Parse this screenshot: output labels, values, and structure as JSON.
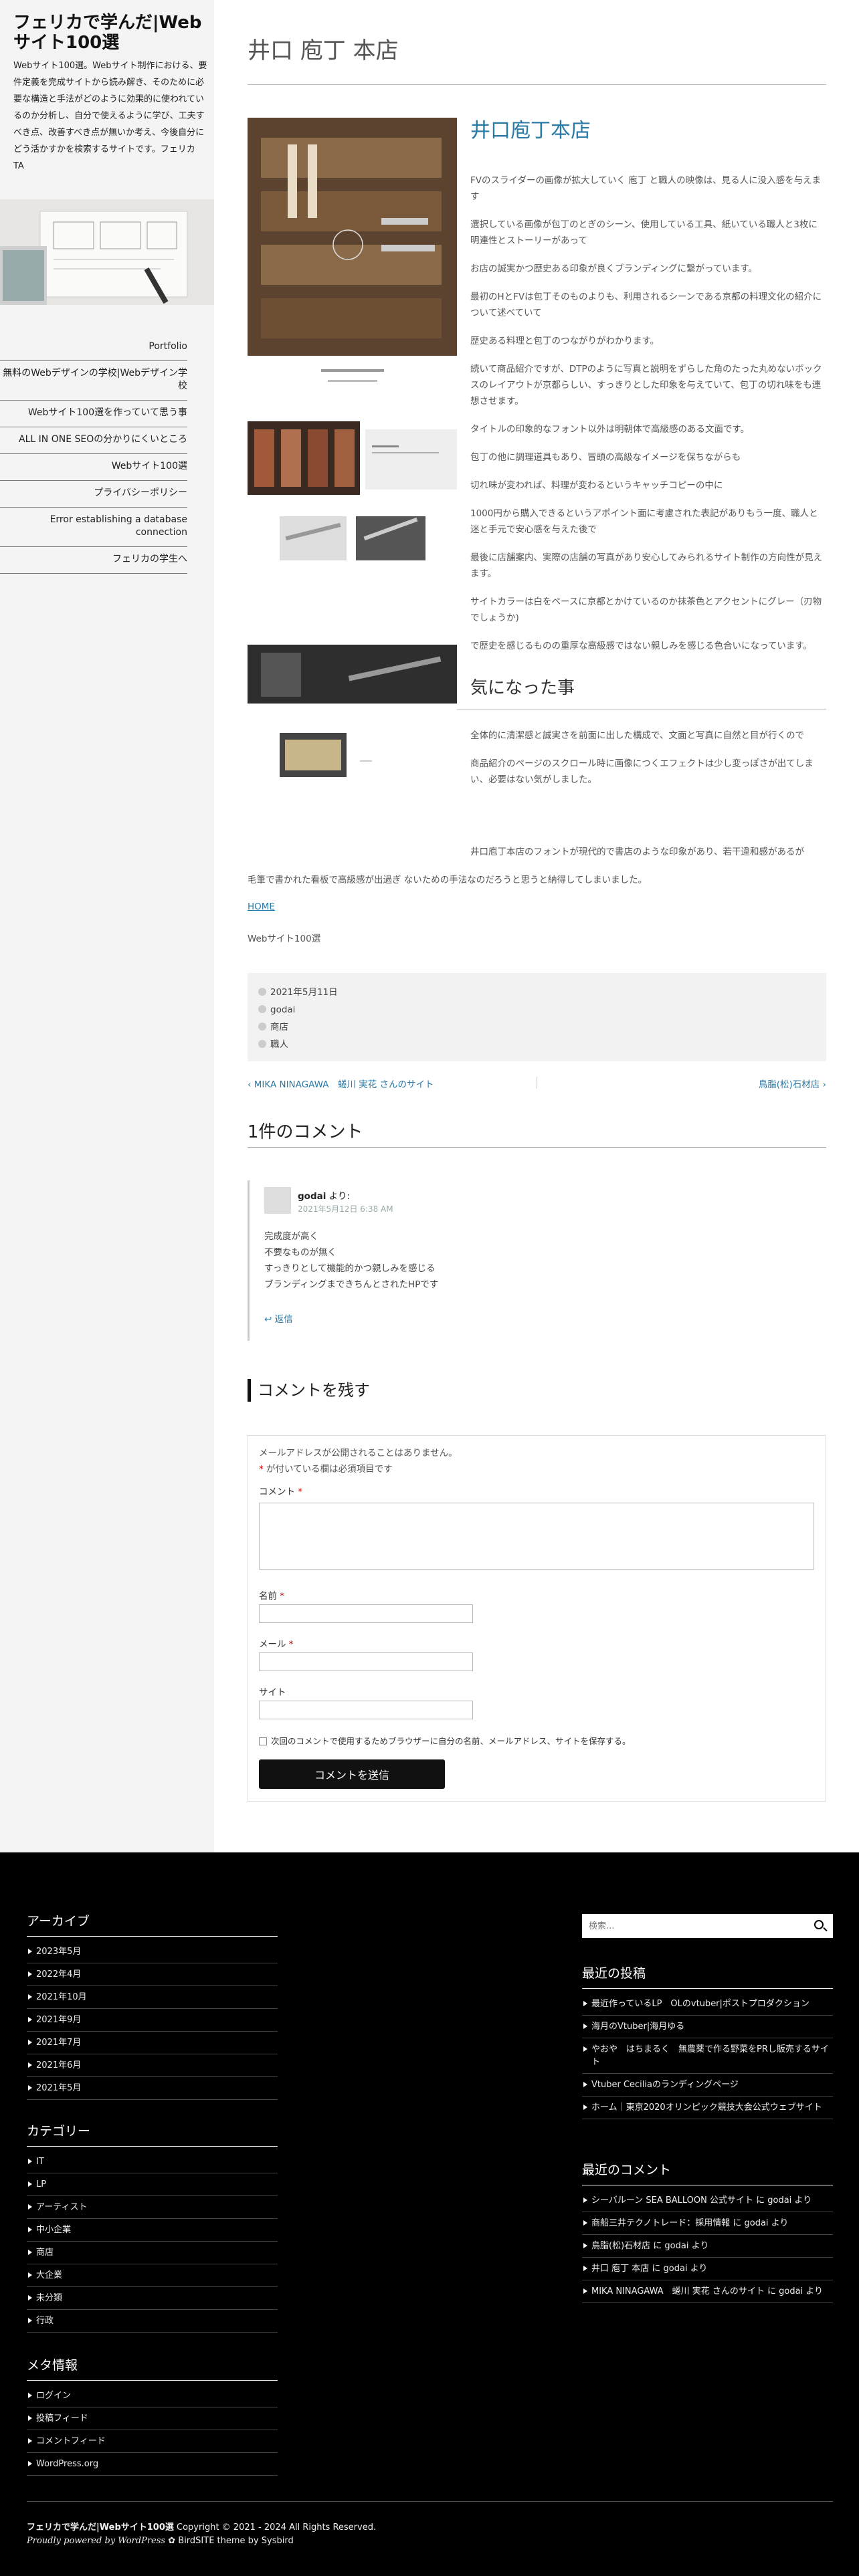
{
  "sidebar": {
    "site_title": "フェリカで学んだ|Webサイト100選",
    "description": "Webサイト100選。Webサイト制作における、要件定義を完成サイトから読み解き、そのために必要な構造と手法がどのように効果的に使われているのか分析し、自分で使えるように学び、工夫すべき点、改善すべき点が無いか考え、今後自分にどう活かすかを検索するサイトです。フェリカ TA",
    "nav": [
      "Portfolio",
      "無料のWebデザインの学校|Webデザイン学校",
      "Webサイト100選を作っていて思う事",
      "ALL IN ONE SEOの分かりにくいところ",
      "Webサイト100選",
      "プライバシーポリシー",
      "Error establishing a database connection",
      "フェリカの学生へ"
    ]
  },
  "post": {
    "title": "井口 庖丁 本店",
    "shop_name": "井口庖丁本店",
    "paragraphs": [
      "FVのスライダーの画像が拡大していく 庖丁 と職人の映像は、見る人に没入感を与えます",
      "選択している画像が包丁のとぎのシーン、使用している工具、紙いている職人と3枚に明連性とストーリーがあって",
      "お店の誠実かつ歴史ある印象が良くブランディングに繋がっています。",
      "最初のHとFVは包丁そのものよりも、利用されるシーンである京都の料理文化の紹介について述べていて",
      "歴史ある料理と包丁のつながりがわかります。",
      "続いて商品紹介ですが、DTPのように写真と説明をずらした角のたった丸めないボックスのレイアウトが京都らしい、すっきりとした印象を与えていて、包丁の切れ味をも連想させます。",
      "タイトルの印象的なフォント以外は明朝体で高級感のある文面です。",
      "包丁の他に調理道具もあり、冒頭の高級なイメージを保ちながらも",
      "切れ味が変われば、料理が変わるというキャッチコピーの中に",
      "1000円から購入できるというアポイント面に考慮された表記がありもう一度、職人と迷と手元で安心感を与えた後で",
      "最後に店舗案内、実際の店舗の写真があり安心してみられるサイト制作の方向性が見えます。",
      "サイトカラーは白をベースに京都とかけているのか抹茶色とアクセントにグレー（刃物でしょうか)",
      "で歴史を感じるものの重厚な高級感ではない親しみを感じる色合いになっています。"
    ],
    "section_title": "気になった事",
    "paragraphs2": [
      "全体的に清潔感と誠実さを前面に出した構成で、文面と写真に自然と目が行くので",
      "商品紹介のページのスクロール時に画像につくエフェクトは少し変っぽさが出てしまい、必要はない気がしました。"
    ],
    "long_paragraph_line1": "井口庖丁本店のフォントが現代的で書店のような印象があり、若干違和感があるが",
    "long_paragraph_line2": "毛筆で書かれた看板で高級感が出過ぎ ないための手法なのだろうと思うと納得してしまいました。",
    "home_link": "HOME",
    "category_text": "Webサイト100選",
    "meta": {
      "date": "2021年5月11日",
      "author": "godai",
      "category": "商店",
      "tag": "職人"
    },
    "prev_post": "MIKA NINAGAWA　蜷川 実花 さんのサイト",
    "next_post": "鳥脂(松)石材店"
  },
  "comments": {
    "title": "1件のコメント",
    "author": "godai",
    "says": "より:",
    "date": "2021年5月12日 6:38 AM",
    "body": [
      "完成度が高く",
      "不要なものが無く",
      "すっきりとして機能的かつ親しみを感じる",
      "ブランディングまできちんとされたHPです"
    ],
    "reply": "返信"
  },
  "form": {
    "title": "コメントを残す",
    "notice": "メールアドレスが公開されることはありません。",
    "required_note": "が付いている欄は必須項目です",
    "required_mark": "*",
    "label_comment": "コメント",
    "label_name": "名前",
    "label_email": "メール",
    "label_site": "サイト",
    "save_text": "次回のコメントで使用するためブラウザーに自分の名前、メールアドレス、サイトを保存する。",
    "submit": "コメントを送信"
  },
  "footer": {
    "archive_title": "アーカイブ",
    "archives": [
      "2023年5月",
      "2022年4月",
      "2021年10月",
      "2021年9月",
      "2021年7月",
      "2021年6月",
      "2021年5月"
    ],
    "category_title": "カテゴリー",
    "categories": [
      "IT",
      "LP",
      "アーティスト",
      "中小企業",
      "商店",
      "大企業",
      "未分類",
      "行政"
    ],
    "meta_title": "メタ情報",
    "meta": [
      "ログイン",
      "投稿フィード",
      "コメントフィード",
      "WordPress.org"
    ],
    "search_placeholder": "検索...",
    "recent_posts_title": "最近の投稿",
    "recent_posts": [
      "最近作っているLP　OLのvtuber|ポストプロダクション",
      "海月のVtuber|海月ゆる",
      "やおや　はちまるく　無農薬で作る野菜をPRし販売するサイト",
      "Vtuber Ceciliaのランディングページ",
      "ホーム｜東京2020オリンピック競技大会公式ウェブサイト"
    ],
    "recent_comments_title": "最近のコメント",
    "recent_comments": [
      "シーバルーン SEA BALLOON 公式サイト に godai より",
      "商船三井テクノトレード：採用情報 に godai より",
      "鳥脂(松)石材店 に godai より",
      "井口 庖丁 本店 に godai より",
      "MIKA NINAGAWA　蜷川 実花 さんのサイト に godai より"
    ],
    "copyright_name": "フェリカで学んだ|Webサイト100選",
    "copyright_rest": " Copyright © 2021 - 2024 All Rights Reserved.",
    "powered": "Proudly powered by WordPress",
    "theme": "BirdSITE theme by Sysbird"
  }
}
